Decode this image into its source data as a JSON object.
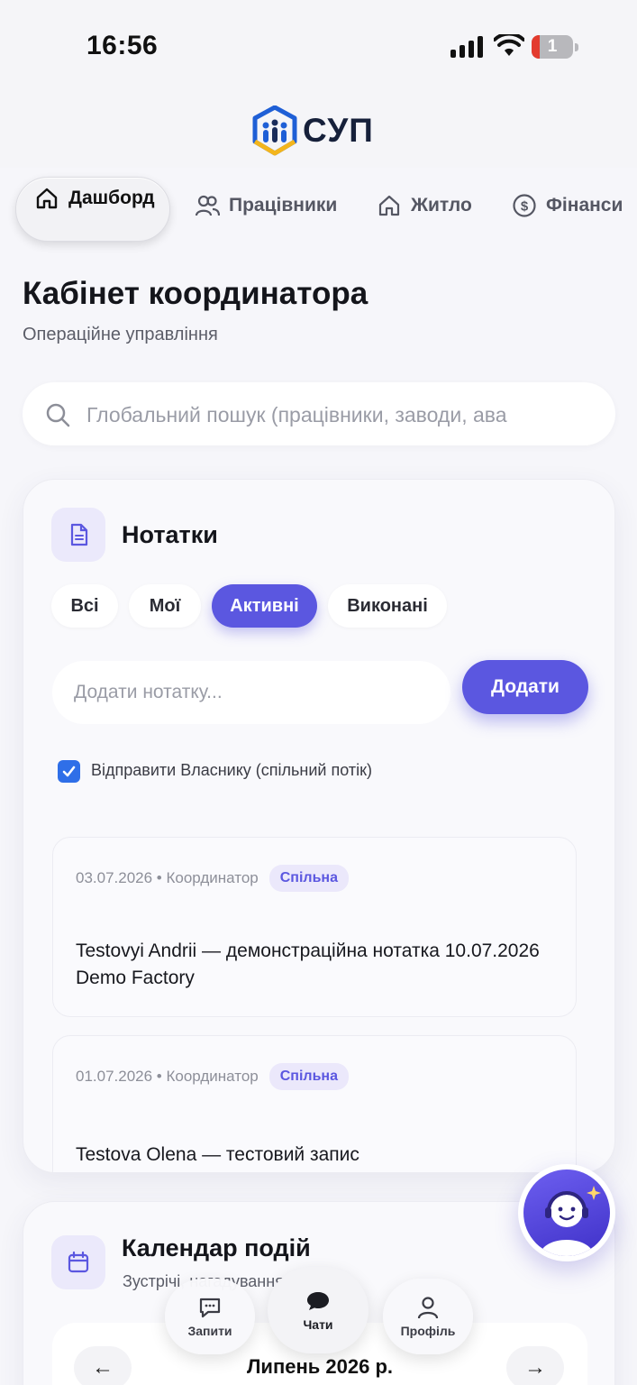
{
  "status_bar": {
    "time": "16:56",
    "battery": "1"
  },
  "header": {
    "logo_text": "СУП"
  },
  "nav": {
    "items": [
      {
        "label": "Дашборд",
        "icon": "home-icon",
        "active": true
      },
      {
        "label": "Працівники",
        "icon": "users-icon"
      },
      {
        "label": "Житло",
        "icon": "home-icon"
      },
      {
        "label": "Фінанси",
        "icon": "dollar-icon"
      }
    ]
  },
  "page": {
    "title": "Кабінет координатора",
    "subtitle": "Операційне управління"
  },
  "search": {
    "placeholder": "Глобальний пошук (працівники, заводи, ава"
  },
  "notes": {
    "title": "Нотатки",
    "filters": [
      "Всі",
      "Мої",
      "Активні",
      "Виконані"
    ],
    "active_filter": "Активні",
    "input_placeholder": "Додати нотатку...",
    "add_label": "Додати",
    "share_label": "Відправити Власнику (спільний потік)",
    "share_checked": true,
    "items": [
      {
        "meta": "03.07.2026 • Координатор",
        "badge": "Спільна",
        "text": "Testovyi Andrii — демонстраційна нотатка 10.07.2026 Demo Factory"
      },
      {
        "meta": "01.07.2026 • Координатор",
        "badge": "Спільна",
        "text": "Testova Olena — тестовий запис"
      }
    ]
  },
  "calendar": {
    "title": "Календар подій",
    "subtitle": "Зустрічі, нагадування, події",
    "month": "Липень 2026 р.",
    "prev": "←",
    "next": "→"
  },
  "tabbar": {
    "requests": "Запити",
    "chats": "Чати",
    "profile": "Профіль"
  },
  "colors": {
    "accent": "#5b57e0",
    "checkbox": "#2f6fe8"
  }
}
